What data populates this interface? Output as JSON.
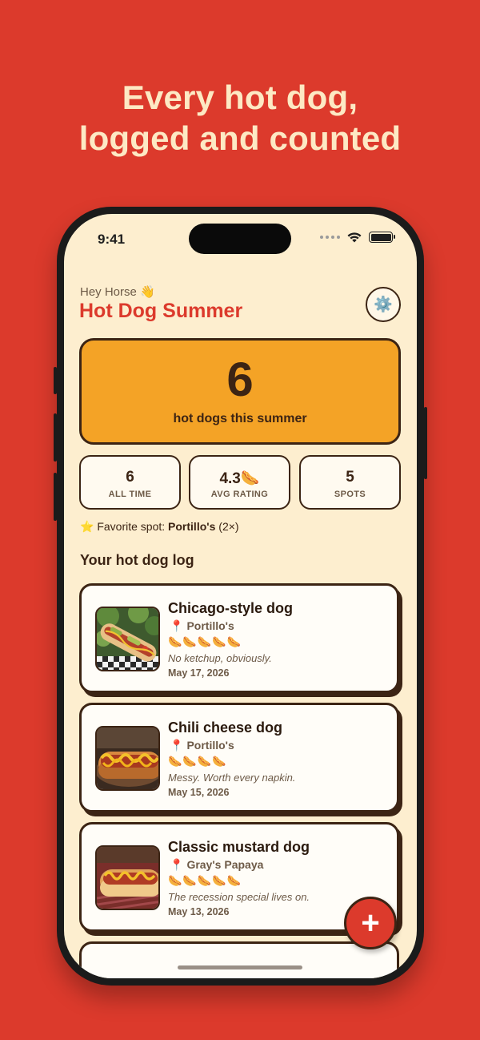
{
  "headline": {
    "line1": "Every hot dog,",
    "line2": "logged and counted"
  },
  "status_bar": {
    "time": "9:41"
  },
  "header": {
    "greeting": "Hey Horse 👋",
    "title": "Hot Dog Summer",
    "settings_icon": "⚙️"
  },
  "hero": {
    "count": "6",
    "label": "hot dogs this summer"
  },
  "stats": [
    {
      "value": "6",
      "label": "ALL TIME"
    },
    {
      "value": "4.3🌭",
      "label": "AVG RATING"
    },
    {
      "value": "5",
      "label": "SPOTS"
    }
  ],
  "favorite": {
    "icon": "⭐",
    "prefix": "Favorite spot:",
    "name": "Portillo's",
    "count": "(2×)"
  },
  "log_title": "Your hot dog log",
  "entries": [
    {
      "title": "Chicago-style dog",
      "pin": "📍",
      "place": "Portillo's",
      "rating": "🌭🌭🌭🌭🌭",
      "rating_value": 5,
      "note": "No ketchup, obviously.",
      "date": "May 17, 2026"
    },
    {
      "title": "Chili cheese dog",
      "pin": "📍",
      "place": "Portillo's",
      "rating": "🌭🌭🌭🌭",
      "rating_value": 4,
      "note": "Messy. Worth every napkin.",
      "date": "May 15, 2026"
    },
    {
      "title": "Classic mustard dog",
      "pin": "📍",
      "place": "Gray's Papaya",
      "rating": "🌭🌭🌭🌭🌭",
      "rating_value": 5,
      "note": "The recession special lives on.",
      "date": "May 13, 2026"
    }
  ],
  "fab": {
    "label": "+"
  },
  "colors": {
    "background": "#dc3a2c",
    "screen": "#fdeecf",
    "accent": "#f4a326",
    "ink": "#3c2414"
  }
}
